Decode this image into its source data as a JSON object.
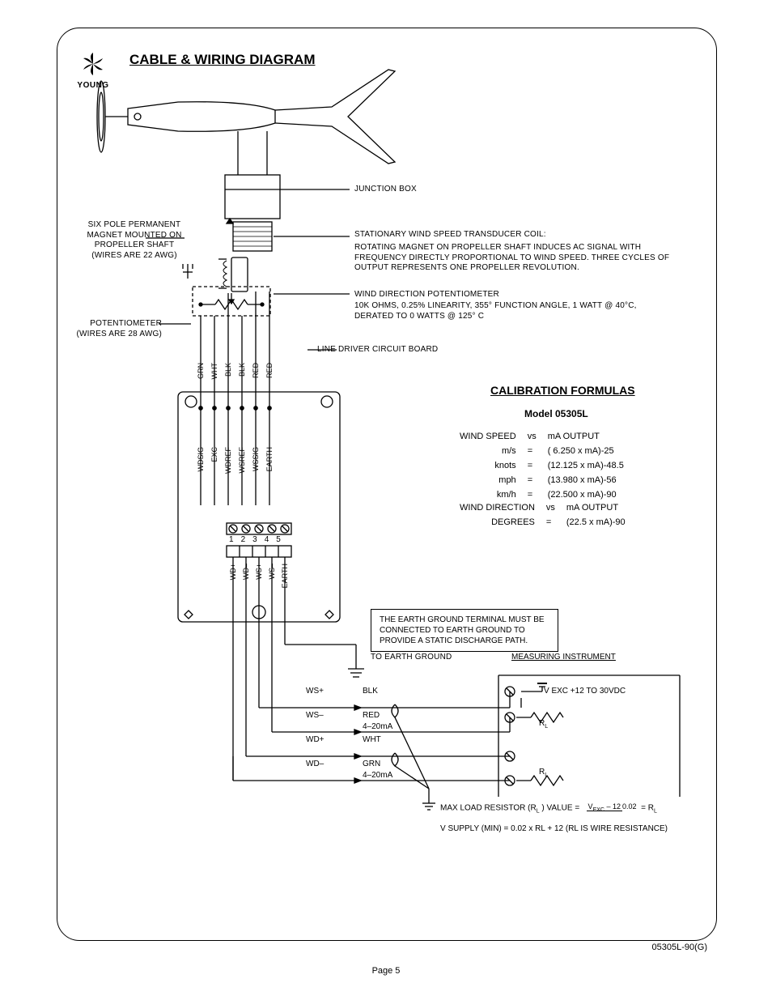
{
  "logo_brand": "YOUNG",
  "title": "CABLE & WIRING DIAGRAM",
  "labels": {
    "junction_box": "JUNCTION BOX",
    "magnet_note": "SIX POLE PERMANENT\nMAGNET MOUNTED ON\nPROPELLER SHAFT\n(WIRES ARE 22 AWG)",
    "pot_note": "POTENTIOMETER\n(WIRES ARE 28 AWG)",
    "coil_title": "STATIONARY WIND SPEED TRANSDUCER COIL:",
    "coil_body": "ROTATING MAGNET ON PROPELLER SHAFT INDUCES AC SIGNAL WITH FREQUENCY DIRECTLY PROPORTIONAL TO WIND SPEED.  THREE CYCLES OF OUTPUT REPRESENTS ONE PROPELLER REVOLUTION.",
    "dir_pot": "WIND DIRECTION POTENTIOMETER",
    "dir_pot_spec": "10K OHMS, 0.25% LINEARITY, 355° FUNCTION ANGLE, 1 WATT @ 40°C, DERATED TO 0 WATTS @ 125° C",
    "line_driver": "LINE DRIVER CIRCUIT BOARD",
    "earth_note": "THE EARTH GROUND TERMINAL MUST BE CONNECTED TO EARTH GROUND TO PROVIDE A STATIC DISCHARGE PATH.",
    "to_earth": "TO EARTH GROUND",
    "meas_instr": "MEASURING INSTRUMENT",
    "vexc": "V EXC +12 TO 30VDC",
    "max_load": "MAX LOAD RESISTOR (R",
    "max_load2": " ) VALUE  =",
    "frac_top": "V",
    "frac_top2": "  – 12",
    "frac_bot": "0.02",
    "eq_rl": "=  R",
    "vsupply": "V SUPPLY (MIN) = 0.02 x RL + 12 (RL IS WIRE RESISTANCE)",
    "rl": "R",
    "four20": "4–20mA"
  },
  "top_wires": [
    "GRN",
    "WHT",
    "BLK",
    "BLK",
    "RED",
    "RED"
  ],
  "mid_wires": [
    "WDSIG",
    "EXC",
    "WDREF",
    "WSREF",
    "WSSIG",
    "EARTH"
  ],
  "terminal_nums": [
    "1",
    "2",
    "3",
    "4",
    "5"
  ],
  "bot_wires": [
    "WD+",
    "WD–",
    "WS+",
    "WS–",
    "EARTH"
  ],
  "outputs": [
    {
      "tag": "WS+",
      "color": "BLK"
    },
    {
      "tag": "WS–",
      "color": "RED"
    },
    {
      "tag": "WD+",
      "color": "WHT"
    },
    {
      "tag": "WD–",
      "color": "GRN"
    }
  ],
  "calibration": {
    "title": "CALIBRATION FORMULAS",
    "model": "Model 05305L",
    "speed_header": [
      "WIND SPEED",
      "vs",
      "mA OUTPUT"
    ],
    "speed_rows": [
      [
        "m/s",
        "=",
        "(  6.250 x mA)-25"
      ],
      [
        "knots",
        "=",
        "(12.125 x mA)-48.5"
      ],
      [
        "mph",
        "=",
        "(13.980 x mA)-56"
      ],
      [
        "km/h",
        "=",
        "(22.500 x mA)-90"
      ]
    ],
    "dir_header": [
      "WIND DIRECTION",
      "vs",
      "mA OUTPUT"
    ],
    "dir_rows": [
      [
        "DEGREES",
        "=",
        "(22.5 x mA)-90"
      ]
    ]
  },
  "doc_id": "05305L-90(G)",
  "page_num": "Page 5"
}
